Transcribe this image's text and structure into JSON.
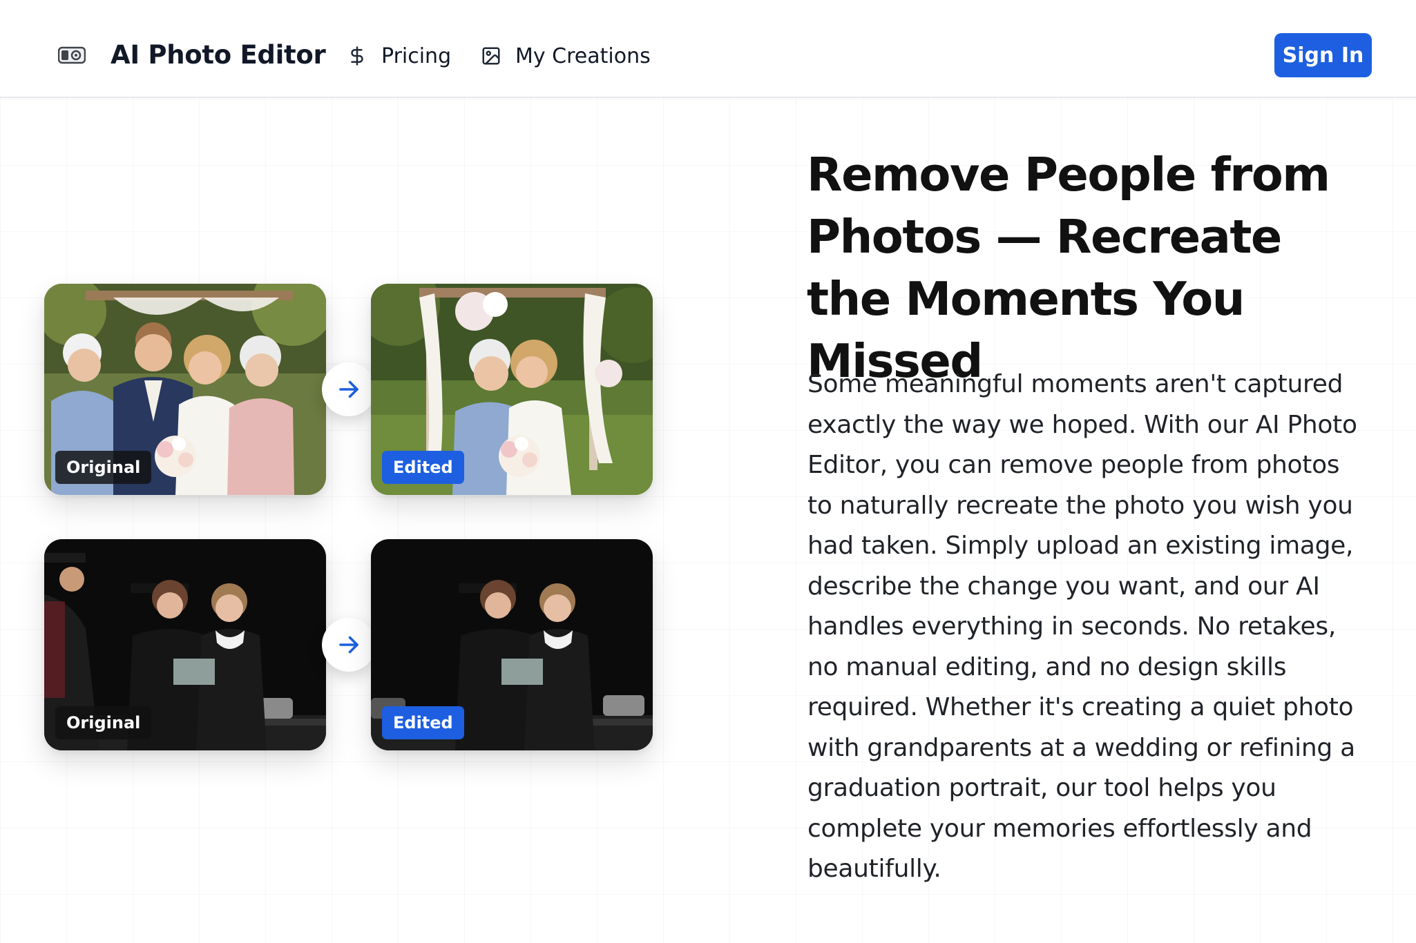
{
  "colors": {
    "accent": "#1d5fe0",
    "text": "#111827",
    "badge_original_bg": "#1a1a1a",
    "badge_edited_bg": "#1d5fe0"
  },
  "header": {
    "logo_icon": "photo-editor-logo-icon",
    "brand": "AI Photo Editor",
    "nav": [
      {
        "icon": "dollar-icon",
        "label": "Pricing"
      },
      {
        "icon": "image-icon",
        "label": "My Creations"
      }
    ],
    "sign_in_label": "Sign In"
  },
  "comparisons": [
    {
      "scene": "wedding",
      "original_label": "Original",
      "edited_label": "Edited",
      "arrow_icon": "arrow-right-icon"
    },
    {
      "scene": "graduation",
      "original_label": "Original",
      "edited_label": "Edited",
      "arrow_icon": "arrow-right-icon"
    }
  ],
  "hero": {
    "title": "Remove People from Photos — Recreate the Moments You Missed",
    "description": "Some meaningful moments aren't captured exactly the way we hoped. With our AI Photo Editor, you can remove people from photos to naturally recreate the photo you wish you had taken. Simply upload an existing image, describe the change you want, and our AI handles everything in seconds. No retakes, no manual editing, and no design skills required. Whether it's creating a quiet photo with grandparents at a wedding or refining a graduation portrait, our tool helps you complete your memories effortlessly and beautifully."
  }
}
